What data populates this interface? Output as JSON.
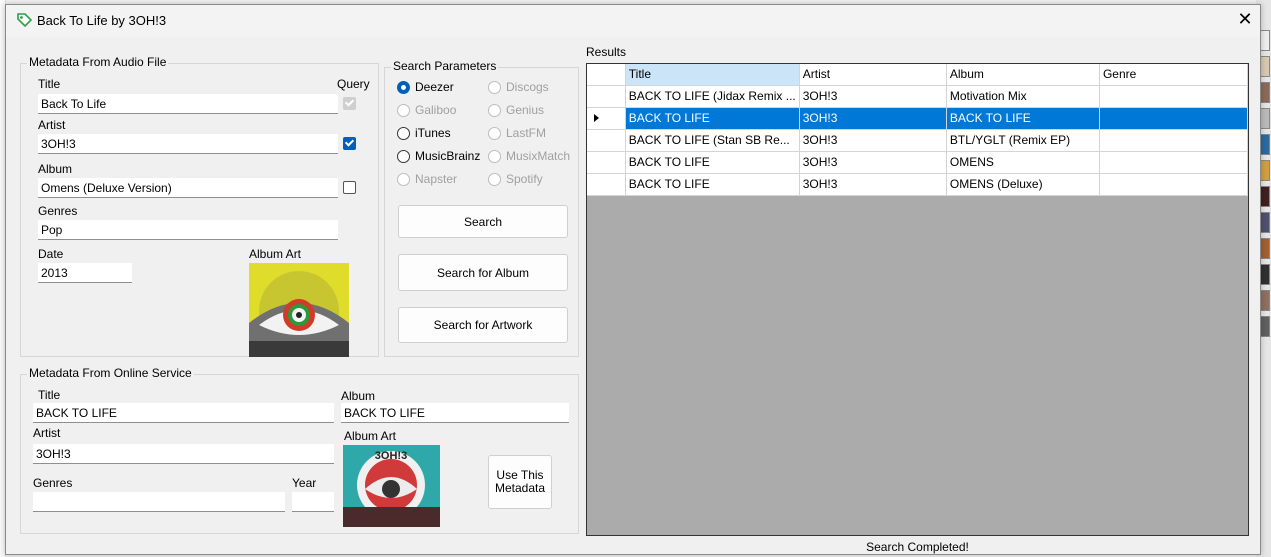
{
  "window": {
    "title": "Back To Life by 3OH!3",
    "close_glyph": "✕"
  },
  "audio_file": {
    "group_label": "Metadata From Audio File",
    "query_label": "Query",
    "title_label": "Title",
    "title_value": "Back To Life",
    "title_query": true,
    "artist_label": "Artist",
    "artist_value": "3OH!3",
    "artist_query": true,
    "album_label": "Album",
    "album_value": "Omens (Deluxe Version)",
    "album_query": false,
    "genres_label": "Genres",
    "genres_value": "Pop",
    "date_label": "Date",
    "date_value": "2013",
    "album_art_label": "Album Art"
  },
  "search_params": {
    "group_label": "Search Parameters",
    "services_left": [
      {
        "label": "Deezer",
        "selected": true,
        "enabled": true
      },
      {
        "label": "Galiboo",
        "selected": false,
        "enabled": false
      },
      {
        "label": "iTunes",
        "selected": false,
        "enabled": true
      },
      {
        "label": "MusicBrainz",
        "selected": false,
        "enabled": true
      },
      {
        "label": "Napster",
        "selected": false,
        "enabled": false
      }
    ],
    "services_right": [
      {
        "label": "Discogs",
        "selected": false,
        "enabled": false
      },
      {
        "label": "Genius",
        "selected": false,
        "enabled": false
      },
      {
        "label": "LastFM",
        "selected": false,
        "enabled": false
      },
      {
        "label": "MusixMatch",
        "selected": false,
        "enabled": false
      },
      {
        "label": "Spotify",
        "selected": false,
        "enabled": false
      }
    ],
    "search_button": "Search",
    "search_album_button": "Search for Album",
    "search_artwork_button": "Search for Artwork"
  },
  "online_service": {
    "group_label": "Metadata From Online Service",
    "title_label": "Title",
    "title_value": "BACK TO LIFE",
    "album_label": "Album",
    "album_value": "BACK TO LIFE",
    "artist_label": "Artist",
    "artist_value": "3OH!3",
    "album_art_label": "Album Art",
    "genres_label": "Genres",
    "genres_value": "",
    "year_label": "Year",
    "year_value": "",
    "use_button_line1": "Use This",
    "use_button_line2": "Metadata"
  },
  "results": {
    "label": "Results",
    "columns": [
      "Title",
      "Artist",
      "Album",
      "Genre"
    ],
    "rows": [
      {
        "title": "BACK TO LIFE (Jidax Remix ...",
        "artist": "3OH!3",
        "album": "Motivation Mix",
        "genre": ""
      },
      {
        "title": "BACK TO LIFE",
        "artist": "3OH!3",
        "album": "BACK TO LIFE",
        "genre": ""
      },
      {
        "title": "BACK TO LIFE (Stan SB Re...",
        "artist": "3OH!3",
        "album": "BTL/YGLT (Remix EP)",
        "genre": ""
      },
      {
        "title": "BACK TO LIFE",
        "artist": "3OH!3",
        "album": "OMENS",
        "genre": ""
      },
      {
        "title": "BACK TO LIFE",
        "artist": "3OH!3",
        "album": "OMENS (Deluxe)",
        "genre": ""
      }
    ],
    "selected_row": 1,
    "status": "Search Completed!"
  },
  "art_online_logo": "3OH!3",
  "colors": {
    "accent": "#0078d7",
    "checkbox": "#005fb8",
    "grid_bg": "#ababab"
  }
}
